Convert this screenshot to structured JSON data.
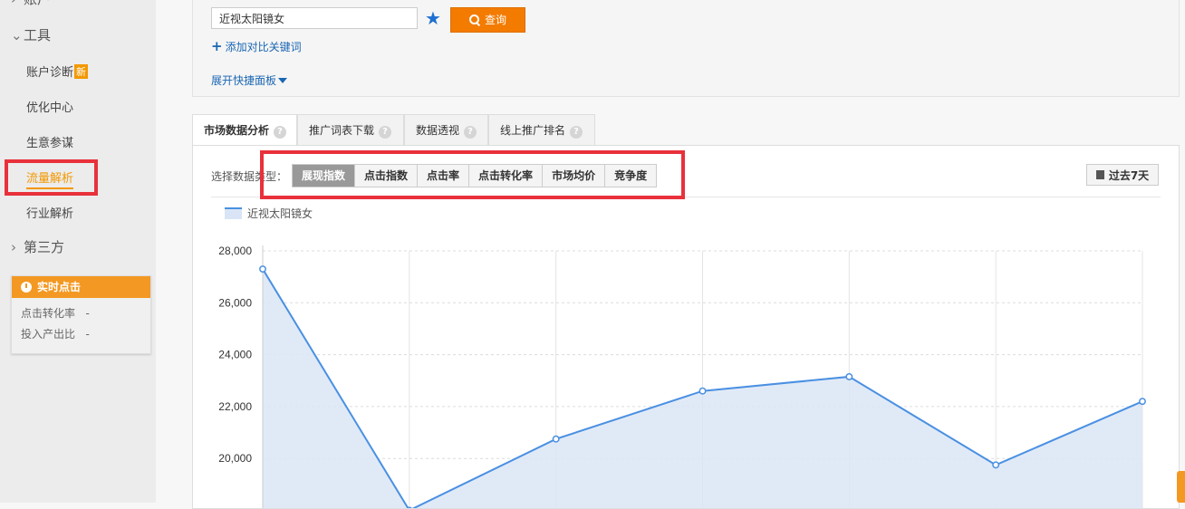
{
  "sidebar": {
    "group_account": "账户",
    "group_tools": "工具",
    "items": [
      {
        "label": "账户诊断",
        "badge": "新"
      },
      {
        "label": "优化中心"
      },
      {
        "label": "生意参谋"
      },
      {
        "label": "流量解析",
        "active": true
      },
      {
        "label": "行业解析"
      }
    ],
    "group_third": "第三方",
    "realtime": {
      "title": "实时点击",
      "rows": [
        {
          "label": "点击转化率",
          "value": "-"
        },
        {
          "label": "投入产出比",
          "value": "-"
        }
      ]
    }
  },
  "search": {
    "keyword": "近视太阳镜女",
    "query_label": "查询",
    "add_compare_label": "添加对比关键词",
    "expand_panel_label": "展开快捷面板"
  },
  "tabs": [
    {
      "label": "市场数据分析",
      "active": true
    },
    {
      "label": "推广词表下载"
    },
    {
      "label": "数据透视"
    },
    {
      "label": "线上推广排名"
    }
  ],
  "data_type": {
    "label": "选择数据类型：",
    "options": [
      "展现指数",
      "点击指数",
      "点击率",
      "点击转化率",
      "市场均价",
      "竞争度"
    ],
    "selected": "展现指数"
  },
  "date_range_label": "过去7天",
  "colors": {
    "accent": "#f39800",
    "line": "#4a90e2",
    "highlight": "#e8313b"
  },
  "chart_data": {
    "type": "area",
    "series": [
      {
        "name": "近视太阳镜女",
        "values": [
          27300,
          18000,
          20750,
          22600,
          23150,
          19750,
          22200
        ]
      }
    ],
    "y_ticks": [
      "28,000",
      "26,000",
      "24,000",
      "22,000",
      "20,000"
    ],
    "ylim": [
      18000,
      28000
    ],
    "grid": true
  }
}
